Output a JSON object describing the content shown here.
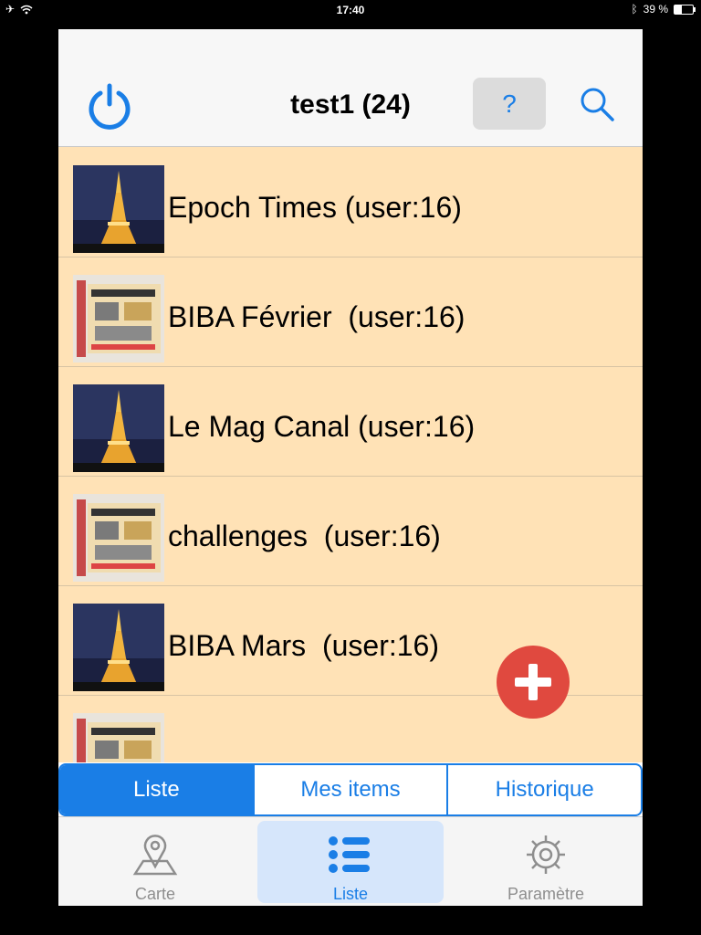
{
  "status_bar": {
    "time": "17:40",
    "battery_text": "39 %",
    "battery_level": 0.39
  },
  "header": {
    "title": "test1 (24)",
    "help_label": "?"
  },
  "items": [
    {
      "label": "Epoch Times (user:16)",
      "thumb": "eiffel-tower"
    },
    {
      "label": "BIBA Février  (user:16)",
      "thumb": "magazine"
    },
    {
      "label": "Le Mag Canal (user:16)",
      "thumb": "eiffel-tower"
    },
    {
      "label": "challenges  (user:16)",
      "thumb": "magazine"
    },
    {
      "label": "BIBA Mars  (user:16)",
      "thumb": "eiffel-tower"
    },
    {
      "label": "",
      "thumb": "magazine"
    }
  ],
  "segments": [
    {
      "label": "Liste",
      "active": true
    },
    {
      "label": "Mes items",
      "active": false
    },
    {
      "label": "Historique",
      "active": false
    }
  ],
  "tabs": [
    {
      "label": "Carte",
      "icon": "map-pin-icon"
    },
    {
      "label": "Liste",
      "icon": "list-icon"
    },
    {
      "label": "Paramètre",
      "icon": "gear-icon"
    }
  ],
  "colors": {
    "accent": "#1a7ee6",
    "list_background": "#ffe2b6",
    "fab": "#e0493f"
  }
}
